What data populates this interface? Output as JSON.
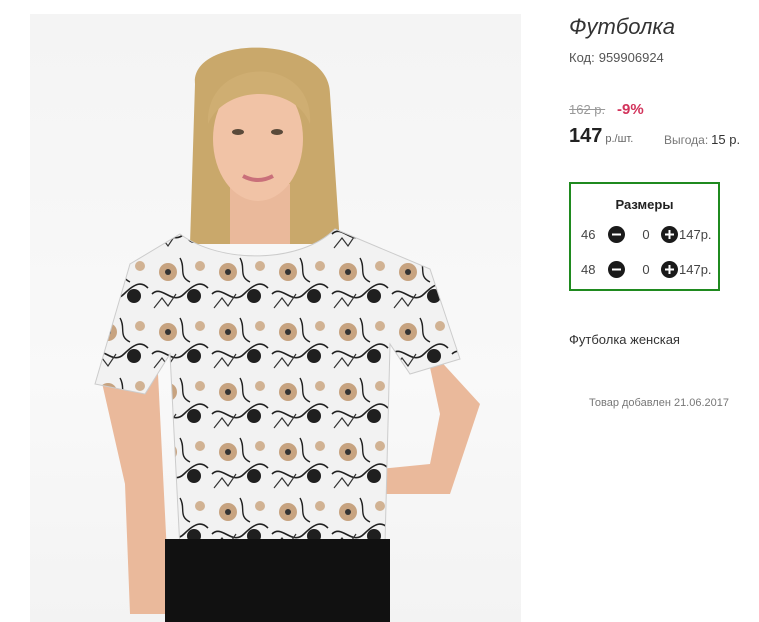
{
  "product": {
    "title": "Футболка",
    "code_label": "Код:",
    "code_value": "959906924",
    "old_price": "162 р.",
    "discount": "-9%",
    "price": "147",
    "price_unit": "р./шт.",
    "benefit_label": "Выгода:",
    "benefit_value": "15 р.",
    "description": "Футболка женская",
    "added": "Товар добавлен 21.06.2017"
  },
  "sizes": {
    "title": "Размеры",
    "rows": [
      {
        "size": "46",
        "qty": "0",
        "price": "147р."
      },
      {
        "size": "48",
        "qty": "0",
        "price": "147р."
      }
    ]
  },
  "colors": {
    "sizes_border": "#1f8a1f",
    "discount": "#d2335b"
  }
}
